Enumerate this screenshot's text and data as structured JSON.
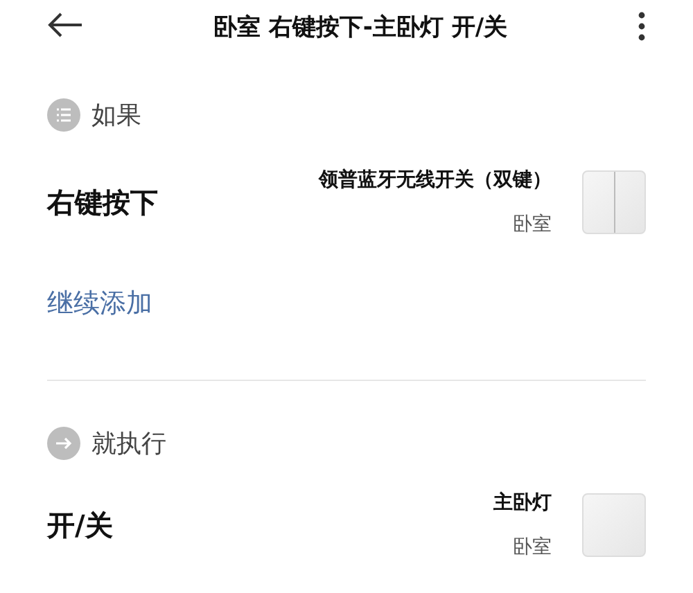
{
  "header": {
    "title": "卧室 右键按下-主卧灯 开/关"
  },
  "sections": [
    {
      "kind": "condition",
      "heading": "如果",
      "rows": [
        {
          "label": "右键按下",
          "device": "领普蓝牙无线开关（双键）",
          "room": "卧室",
          "kind": "double"
        }
      ],
      "add_link": "继续添加"
    },
    {
      "kind": "action",
      "heading": "就执行",
      "rows": [
        {
          "label": "开/关",
          "device": "主卧灯",
          "room": "卧室",
          "kind": "single"
        }
      ]
    }
  ]
}
